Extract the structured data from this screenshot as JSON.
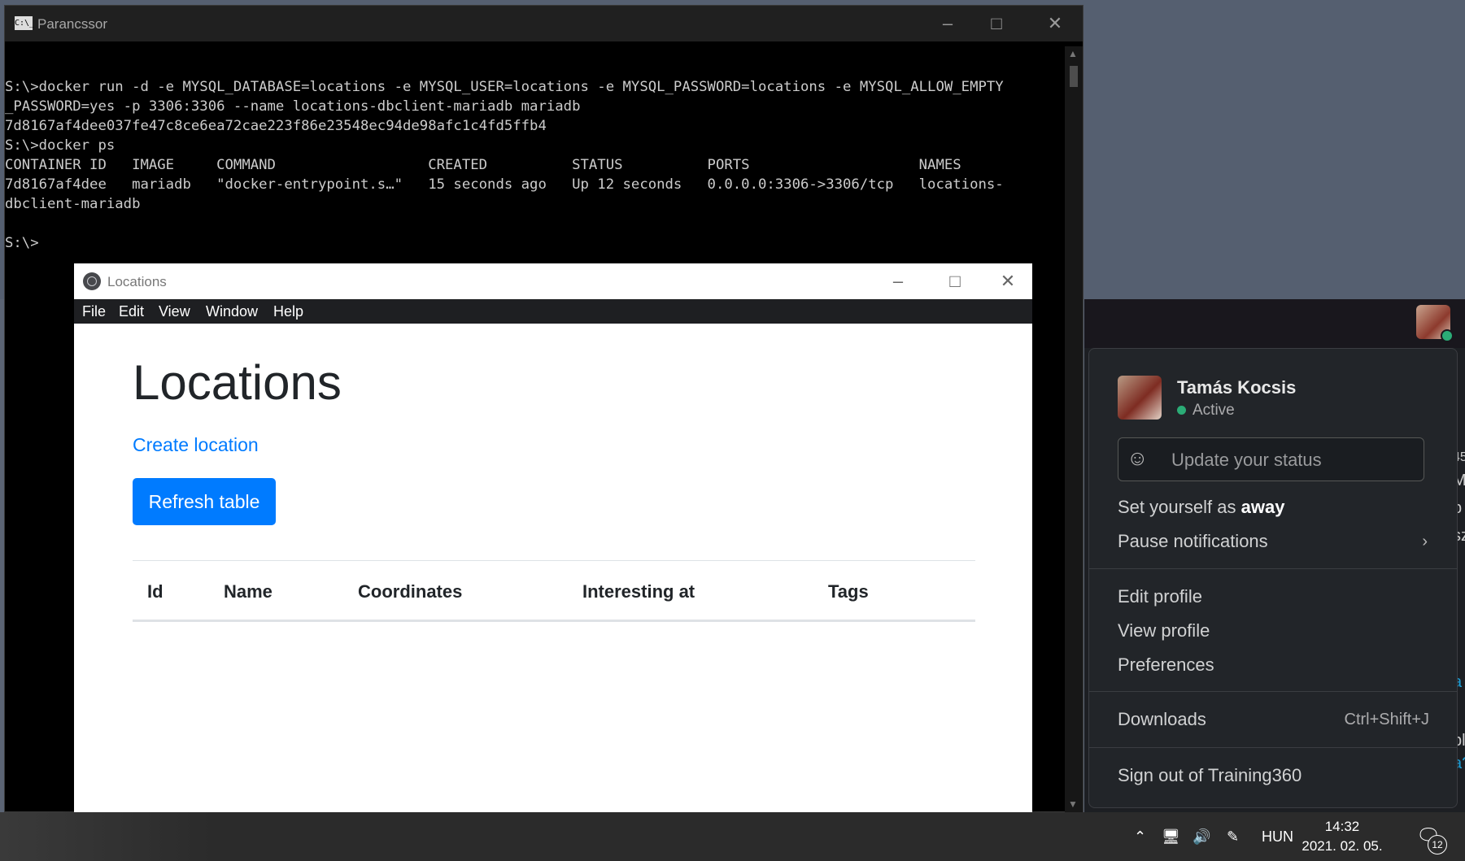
{
  "console": {
    "title": "Parancssor",
    "lines": [
      "S:\\>docker run -d -e MYSQL_DATABASE=locations -e MYSQL_USER=locations -e MYSQL_PASSWORD=locations -e MYSQL_ALLOW_EMPTY",
      "_PASSWORD=yes -p 3306:3306 --name locations-dbclient-mariadb mariadb",
      "7d8167af4dee037fe47c8ce6ea72cae223f86e23548ec94de98afc1c4fd5ffb4",
      "",
      "S:\\>docker ps",
      "CONTAINER ID   IMAGE     COMMAND                  CREATED          STATUS          PORTS                    NAMES",
      "7d8167af4dee   mariadb   \"docker-entrypoint.s…\"   15 seconds ago   Up 12 seconds   0.0.0.0:3306->3306/tcp   locations-",
      "dbclient-mariadb",
      "",
      "S:\\>"
    ]
  },
  "app": {
    "title": "Locations",
    "menu": [
      "File",
      "Edit",
      "View",
      "Window",
      "Help"
    ],
    "heading": "Locations",
    "create_link": "Create location",
    "refresh_button": "Refresh table",
    "table_headers": [
      "Id",
      "Name",
      "Coordinates",
      "Interesting at",
      "Tags"
    ]
  },
  "slack_menu": {
    "user_name": "Tamás Kocsis",
    "presence": "Active",
    "status_placeholder": "Update your status",
    "set_away_prefix": "Set yourself as ",
    "set_away_bold": "away",
    "pause_notifications": "Pause notifications",
    "edit_profile": "Edit profile",
    "view_profile": "View profile",
    "preferences": "Preferences",
    "downloads": "Downloads",
    "downloads_shortcut": "Ctrl+Shift+J",
    "sign_out": "Sign out of Training360"
  },
  "right_edge": [
    "45",
    "M",
    "b",
    "sz",
    "a",
    "bl",
    "a?"
  ],
  "taskbar": {
    "language": "HUN",
    "time": "14:32",
    "date": "2021. 02. 05.",
    "notification_count": "12"
  },
  "colors": {
    "accent": "#007bff",
    "presence": "#2bac76",
    "menu_bg": "#222529",
    "console_bg": "#000000"
  }
}
